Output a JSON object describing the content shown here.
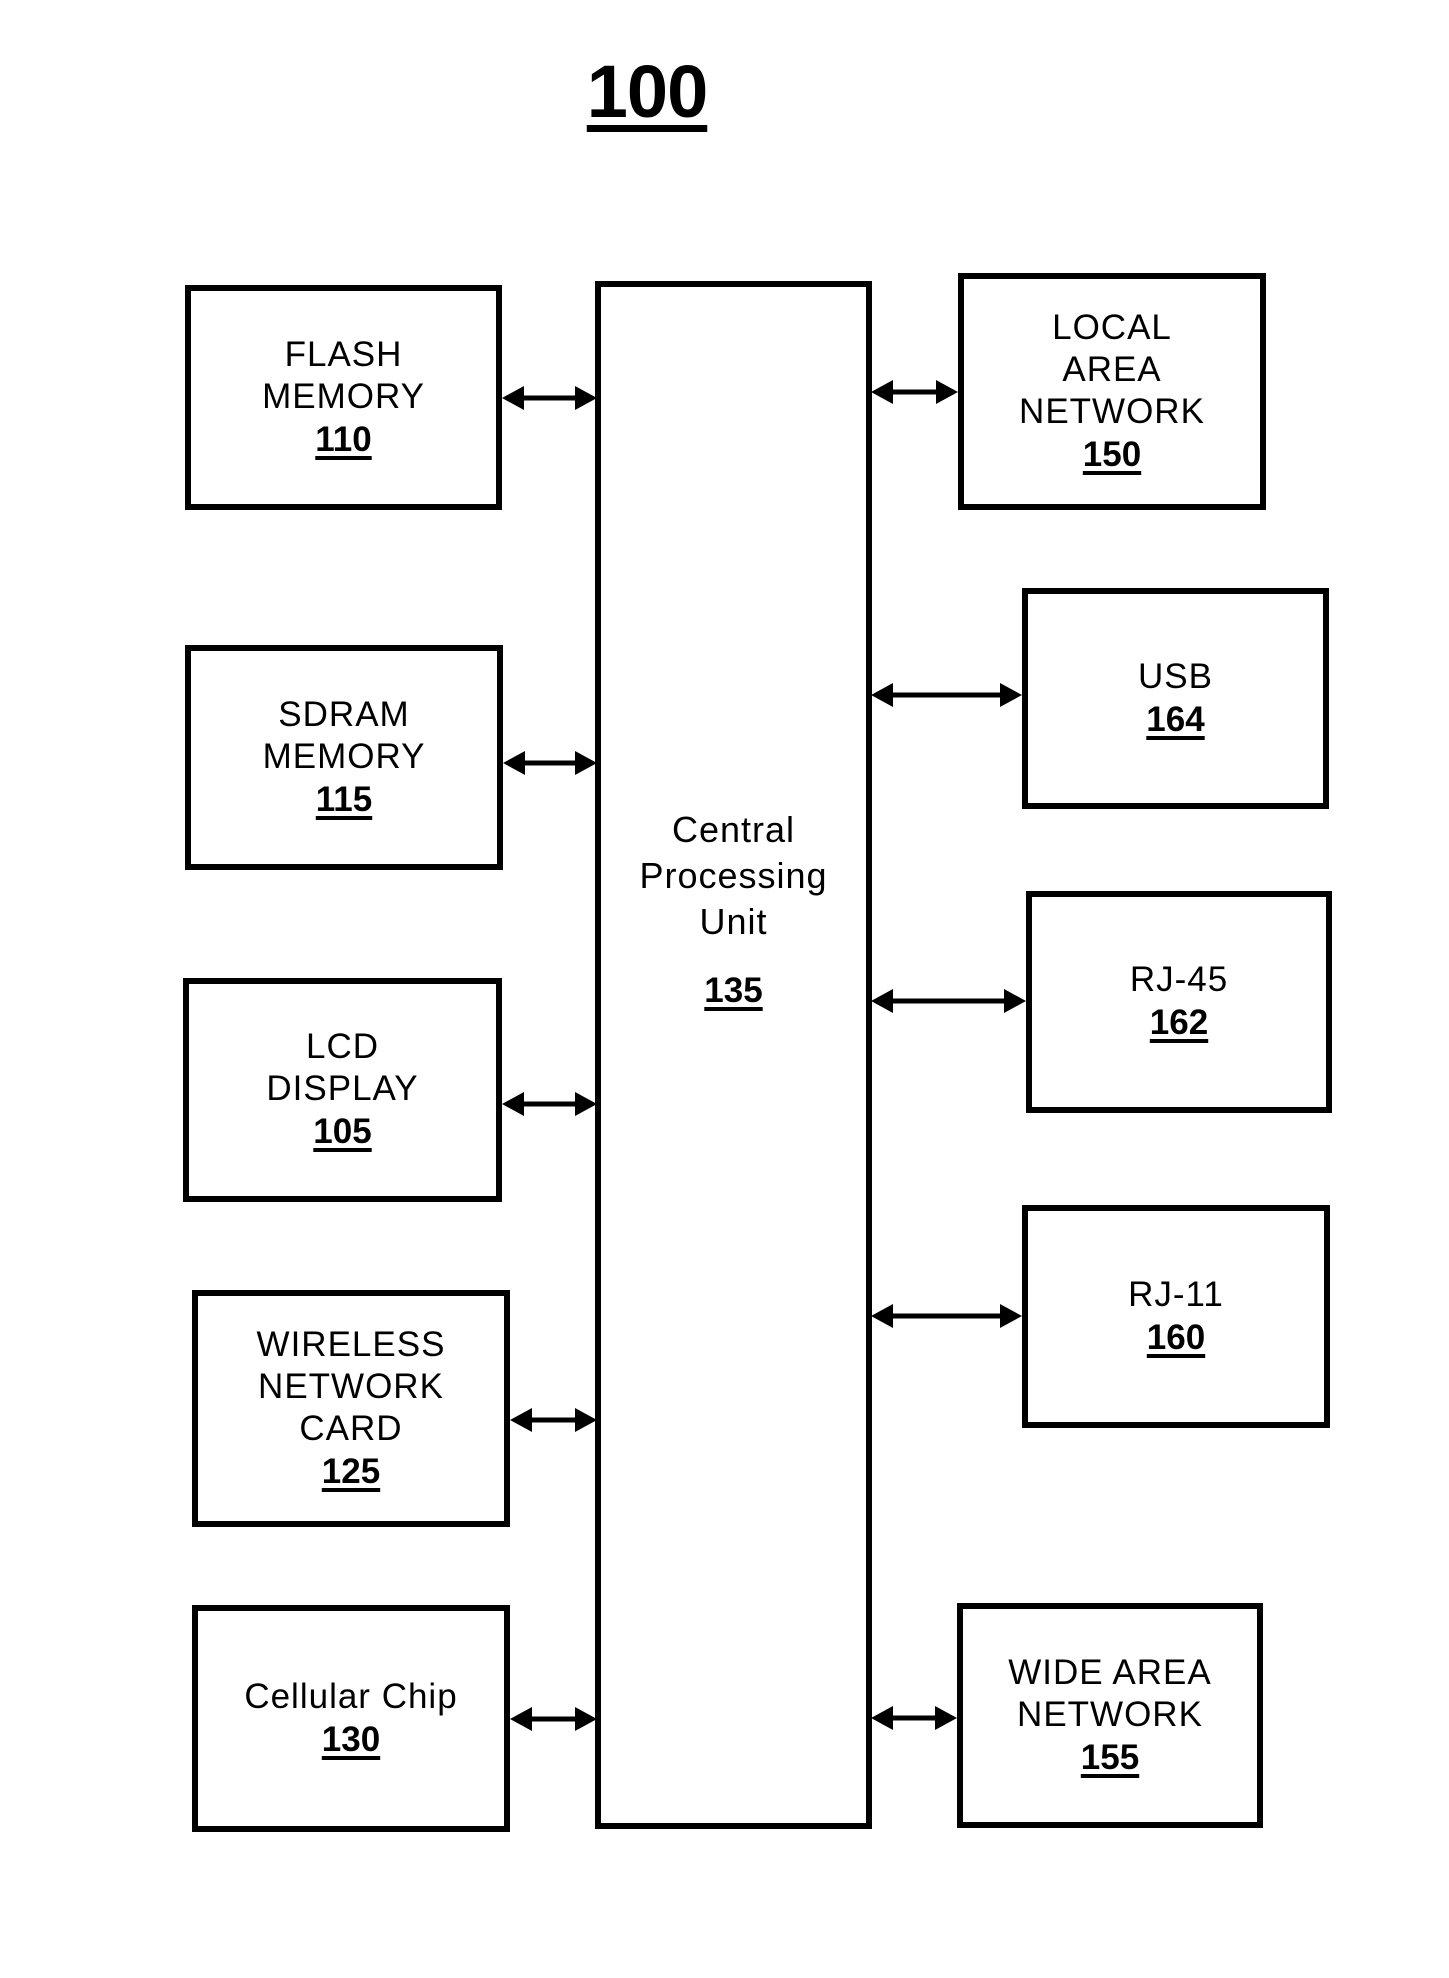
{
  "figure": {
    "title": "100"
  },
  "cpu": {
    "lines": [
      "Central",
      "Processing",
      "Unit"
    ],
    "ref": "135"
  },
  "left_components": [
    {
      "id": "flash-memory",
      "lines": [
        "FLASH",
        "MEMORY"
      ],
      "ref": "110"
    },
    {
      "id": "sdram-memory",
      "lines": [
        "SDRAM",
        "MEMORY"
      ],
      "ref": "115"
    },
    {
      "id": "lcd-display",
      "lines": [
        "LCD",
        "DISPLAY"
      ],
      "ref": "105"
    },
    {
      "id": "wireless-network-card",
      "lines": [
        "WIRELESS",
        "NETWORK",
        "CARD"
      ],
      "ref": "125"
    },
    {
      "id": "cellular-chip",
      "lines": [
        "Cellular Chip"
      ],
      "ref": "130"
    }
  ],
  "right_components": [
    {
      "id": "local-area-network",
      "lines": [
        "LOCAL",
        "AREA",
        "NETWORK"
      ],
      "ref": "150"
    },
    {
      "id": "usb",
      "lines": [
        "USB"
      ],
      "ref": "164"
    },
    {
      "id": "rj-45",
      "lines": [
        "RJ-45"
      ],
      "ref": "162"
    },
    {
      "id": "rj-11",
      "lines": [
        "RJ-11"
      ],
      "ref": "160"
    },
    {
      "id": "wide-area-network",
      "lines": [
        "WIDE AREA",
        "NETWORK"
      ],
      "ref": "155"
    }
  ],
  "connections": [
    {
      "from": "flash-memory",
      "to": "cpu",
      "type": "bidirectional"
    },
    {
      "from": "sdram-memory",
      "to": "cpu",
      "type": "bidirectional"
    },
    {
      "from": "lcd-display",
      "to": "cpu",
      "type": "bidirectional"
    },
    {
      "from": "wireless-network-card",
      "to": "cpu",
      "type": "bidirectional"
    },
    {
      "from": "cellular-chip",
      "to": "cpu",
      "type": "bidirectional"
    },
    {
      "from": "cpu",
      "to": "local-area-network",
      "type": "bidirectional"
    },
    {
      "from": "cpu",
      "to": "usb",
      "type": "bidirectional"
    },
    {
      "from": "cpu",
      "to": "rj-45",
      "type": "bidirectional"
    },
    {
      "from": "cpu",
      "to": "rj-11",
      "type": "bidirectional"
    },
    {
      "from": "cpu",
      "to": "wide-area-network",
      "type": "bidirectional"
    }
  ]
}
